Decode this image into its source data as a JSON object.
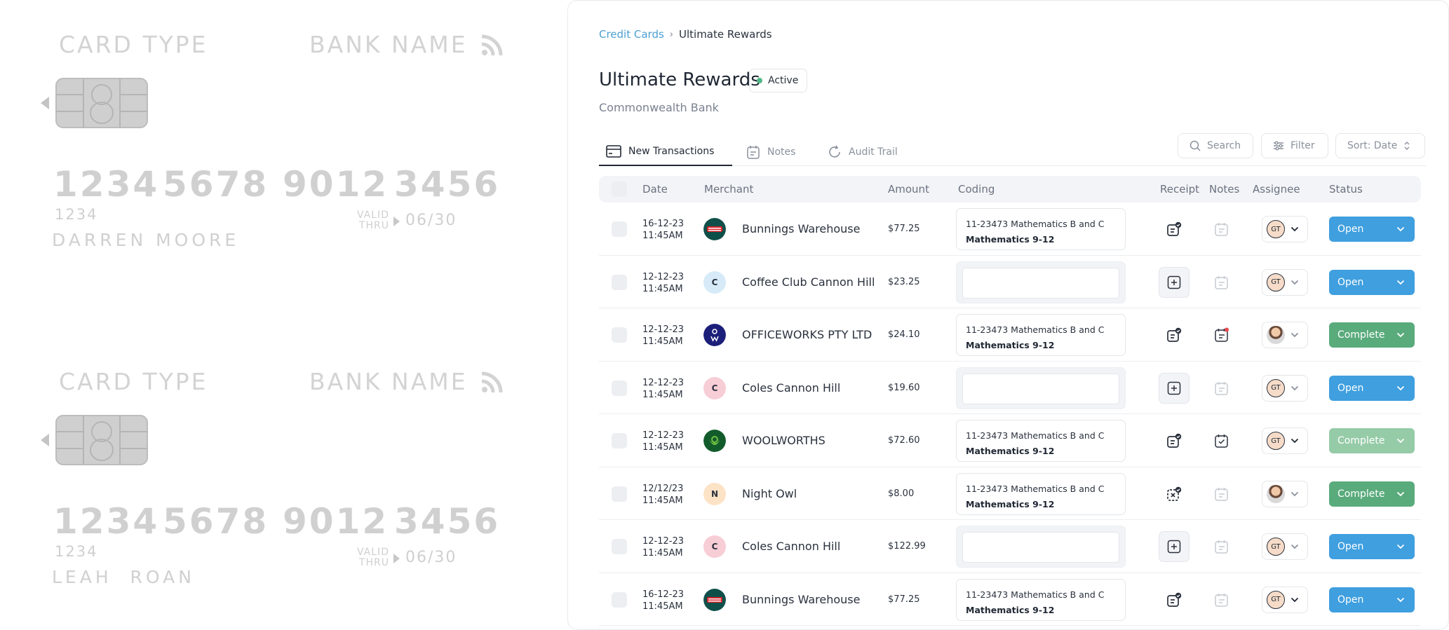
{
  "cards": [
    {
      "card_type": "CARD TYPE",
      "bank_name": "BANK NAME",
      "number": [
        "1234",
        "5678",
        "9012",
        "3456"
      ],
      "small_number": "1234",
      "valid_label": "VALID",
      "thru_label": "THRU",
      "expiry": "06/30",
      "holder": "DARREN MOORE"
    },
    {
      "card_type": "CARD TYPE",
      "bank_name": "BANK NAME",
      "number": [
        "1234",
        "5678",
        "9012",
        "3456"
      ],
      "small_number": "1234",
      "valid_label": "VALID",
      "thru_label": "THRU",
      "expiry": "06/30",
      "holder": "LEAH  ROAN"
    }
  ],
  "breadcrumb": {
    "parent": "Credit Cards",
    "separator": "›",
    "current": "Ultimate Rewards"
  },
  "header": {
    "title": "Ultimate Rewards",
    "status": "Active",
    "subtitle": "Commonwealth Bank"
  },
  "tabs": [
    {
      "label": "New Transactions",
      "icon": "card-icon"
    },
    {
      "label": "Notes",
      "icon": "notes-icon"
    },
    {
      "label": "Audit Trail",
      "icon": "refresh-icon"
    }
  ],
  "toolbar": {
    "search": "Search",
    "filter": "Filter",
    "sort": "Sort: Date"
  },
  "table": {
    "headers": {
      "date": "Date",
      "merchant": "Merchant",
      "amount": "Amount",
      "coding": "Coding",
      "receipt": "Receipt",
      "notes": "Notes",
      "assignee": "Assignee",
      "status": "Status"
    },
    "rows": [
      {
        "date": "16-12-23",
        "time": "11:45AM",
        "merchant": "Bunnings Warehouse",
        "logo": "bunnings",
        "amount": "$77.25",
        "coding1": "11-23473 Mathematics B and C",
        "coding2": "Mathematics 9-12",
        "receipt": "attached",
        "note": "empty",
        "assignee": "GT",
        "status": "Open"
      },
      {
        "date": "12-12-23",
        "time": "11:45AM",
        "merchant": "Coffee Club Cannon Hill",
        "logo": "C",
        "amount": "$23.25",
        "coding1": "",
        "coding2": "",
        "receipt": "add",
        "note": "empty",
        "assignee": "GT",
        "status": "Open"
      },
      {
        "date": "12-12-23",
        "time": "11:45AM",
        "merchant": "OFFICEWORKS PTY LTD",
        "logo": "officeworks",
        "amount": "$24.10",
        "coding1": "11-23473 Mathematics B and C",
        "coding2": "Mathematics 9-12",
        "receipt": "attached",
        "note": "new",
        "assignee": "photo",
        "status": "Complete"
      },
      {
        "date": "12-12-23",
        "time": "11:45AM",
        "merchant": "Coles Cannon Hill",
        "logo": "C",
        "amount": "$19.60",
        "coding1": "",
        "coding2": "",
        "receipt": "add",
        "note": "empty",
        "assignee": "GT",
        "status": "Open"
      },
      {
        "date": "12-12-23",
        "time": "11:45AM",
        "merchant": "WOOLWORTHS",
        "logo": "woolworths",
        "amount": "$72.60",
        "coding1": "11-23473 Mathematics B and C",
        "coding2": "Mathematics 9-12",
        "receipt": "attached",
        "note": "filled",
        "assignee": "GT",
        "status": "Complete"
      },
      {
        "date": "12/12/23",
        "time": "11:45AM",
        "merchant": "Night Owl",
        "logo": "N",
        "amount": "$8.00",
        "coding1": "11-23473 Mathematics B and C",
        "coding2": "Mathematics 9-12",
        "receipt": "missing",
        "note": "empty",
        "assignee": "photo",
        "status": "Complete"
      },
      {
        "date": "12-12-23",
        "time": "11:45AM",
        "merchant": "Coles Cannon Hill",
        "logo": "C",
        "amount": "$122.99",
        "coding1": "",
        "coding2": "",
        "receipt": "add",
        "note": "empty",
        "assignee": "GT",
        "status": "Open"
      },
      {
        "date": "16-12-23",
        "time": "11:45AM",
        "merchant": "Bunnings Warehouse",
        "logo": "bunnings",
        "amount": "$77.25",
        "coding1": "11-23473 Mathematics B and C",
        "coding2": "Mathematics 9-12",
        "receipt": "attached",
        "note": "empty",
        "assignee": "GT",
        "status": "Open"
      }
    ]
  },
  "colors": {
    "accent": "#3f9fdf",
    "complete": "#5aab7c",
    "active_dot": "#52b788",
    "link": "#4c9fd1"
  }
}
